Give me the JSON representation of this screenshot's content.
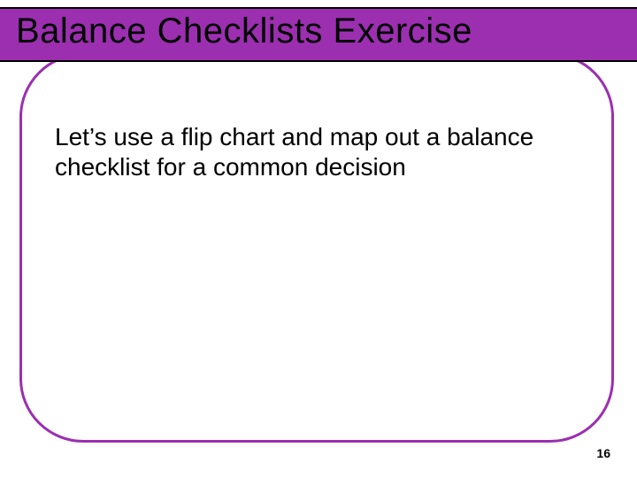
{
  "slide": {
    "title": "Balance Checklists Exercise",
    "body": "Let’s use a flip chart and map out a balance checklist for a common decision",
    "page_number": "16"
  },
  "colors": {
    "accent": "#9b2fb0"
  }
}
